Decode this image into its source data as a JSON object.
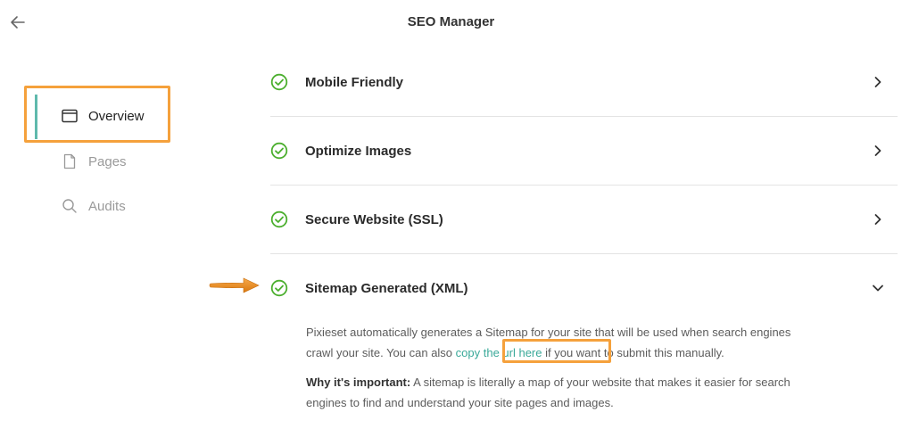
{
  "header": {
    "title": "SEO Manager"
  },
  "sidebar": {
    "items": [
      {
        "label": "Overview",
        "icon": "browser-window-icon",
        "active": true
      },
      {
        "label": "Pages",
        "icon": "document-icon",
        "active": false
      },
      {
        "label": "Audits",
        "icon": "search-icon",
        "active": false
      }
    ]
  },
  "checks": [
    {
      "title": "Mobile Friendly",
      "status": "passed",
      "expanded": false
    },
    {
      "title": "Optimize Images",
      "status": "passed",
      "expanded": false
    },
    {
      "title": "Secure Website (SSL)",
      "status": "passed",
      "expanded": false
    },
    {
      "title": "Sitemap Generated (XML)",
      "status": "passed",
      "expanded": true
    }
  ],
  "sitemap_details": {
    "text_before_link": "Pixieset automatically generates a Sitemap for your site that will be used when search engines crawl your site. You can also ",
    "link_label": "copy the url here",
    "text_after_link": " if you want to submit this manually.",
    "importance_label": "Why it's important:",
    "importance_text": " A sitemap is literally a map of your website that makes it easier for search engines to find and understand your site pages and images."
  },
  "colors": {
    "accent": "#5fb9ac",
    "check_green": "#4caf2f",
    "highlight": "#f5a13c",
    "link": "#3aa999"
  }
}
